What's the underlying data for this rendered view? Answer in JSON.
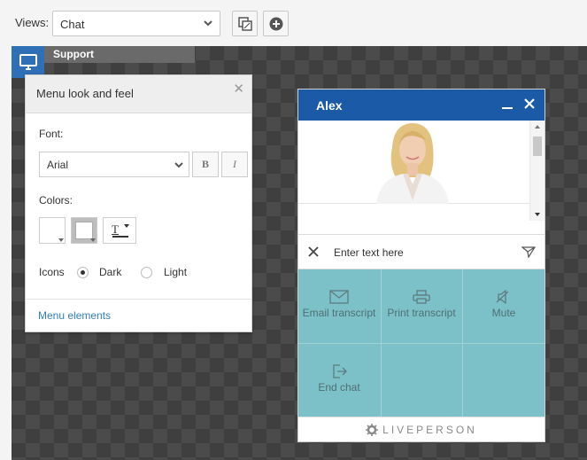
{
  "toolbar": {
    "views_label": "Views:",
    "views_value": "Chat"
  },
  "canvas": {
    "tab_label": "Support"
  },
  "menu": {
    "title": "Menu look and feel",
    "font_label": "Font:",
    "font_value": "Arial",
    "bold_label": "B",
    "italic_label": "I",
    "colors_label": "Colors:",
    "text_color_glyph": "T",
    "icons_label": "Icons",
    "icon_options": [
      "Dark",
      "Light"
    ],
    "icons_selected": "Dark",
    "footer_link": "Menu elements"
  },
  "chat": {
    "agent_name": "Alex",
    "input_placeholder": "Enter text here",
    "actions": [
      {
        "label": "Email transcript",
        "icon": "envelope-icon"
      },
      {
        "label": "Print transcript",
        "icon": "printer-icon"
      },
      {
        "label": "Mute",
        "icon": "speaker-mute-icon"
      },
      {
        "label": "End chat",
        "icon": "exit-door-icon"
      }
    ],
    "brand": "LIVEPERSON",
    "header_color": "#1a5aa6",
    "action_bg": "#7dc1c8"
  }
}
